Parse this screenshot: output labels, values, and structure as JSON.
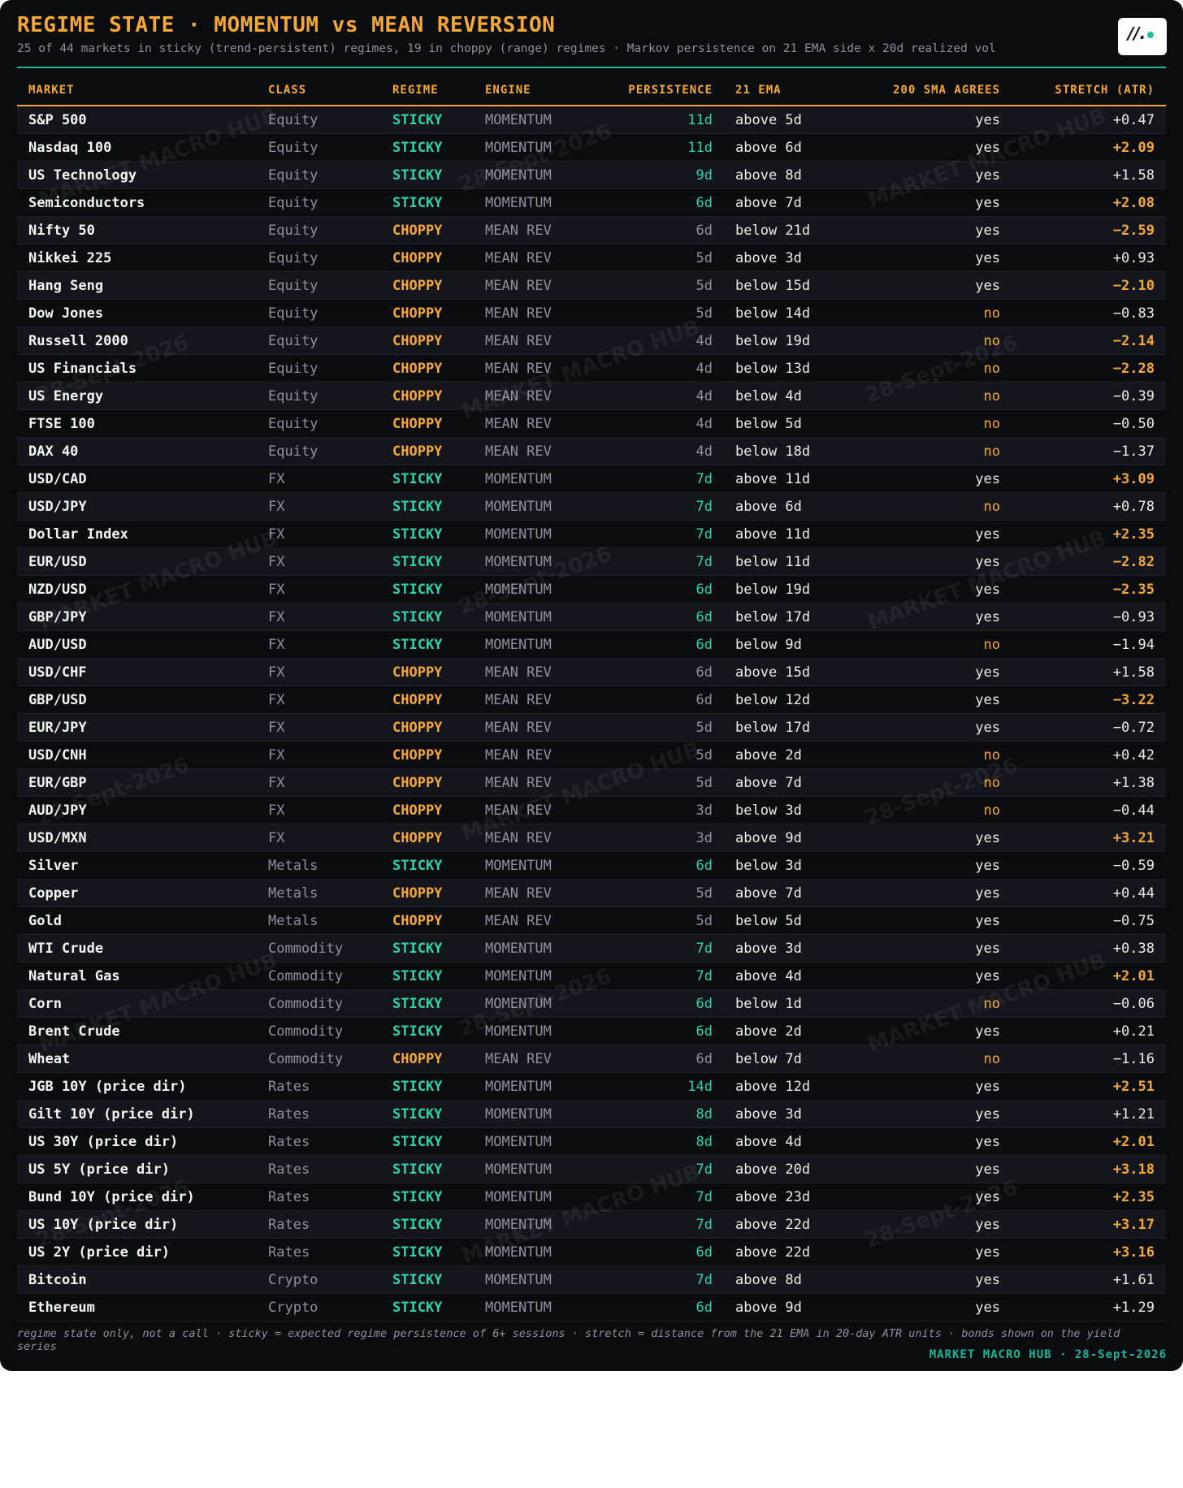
{
  "header": {
    "title": "REGIME STATE · MOMENTUM vs MEAN REVERSION",
    "subtitle": "25 of 44 markets in sticky (trend-persistent) regimes, 19 in choppy (range) regimes · Markov persistence on 21 EMA side x 20d realized vol",
    "logo_text": "MARKET MACRO HUB"
  },
  "colors": {
    "sticky": "#2ed3a8",
    "choppy": "#f6a836",
    "sticky_persistence": "#2ed3a8",
    "choppy_persistence": "#8d929b",
    "yes": "#ececec",
    "no": "#f6a836",
    "stretch_high": "#f6a836",
    "stretch_normal": "#ececec",
    "accent_rule": "#1fb596",
    "background": "#0b0c10"
  },
  "watermark": {
    "brand": "MARKET MACRO HUB",
    "date": "28-Sept-2026"
  },
  "chart_data": {
    "type": "table",
    "columns": [
      "MARKET",
      "CLASS",
      "REGIME",
      "ENGINE",
      "PERSISTENCE",
      "21 EMA",
      "200 SMA AGREES",
      "STRETCH (ATR)"
    ],
    "rows": [
      [
        "S&P 500",
        "Equity",
        "STICKY",
        "MOMENTUM",
        "11d",
        "above 5d",
        "yes",
        "+0.47"
      ],
      [
        "Nasdaq 100",
        "Equity",
        "STICKY",
        "MOMENTUM",
        "11d",
        "above 6d",
        "yes",
        "+2.09"
      ],
      [
        "US Technology",
        "Equity",
        "STICKY",
        "MOMENTUM",
        "9d",
        "above 8d",
        "yes",
        "+1.58"
      ],
      [
        "Semiconductors",
        "Equity",
        "STICKY",
        "MOMENTUM",
        "6d",
        "above 7d",
        "yes",
        "+2.08"
      ],
      [
        "Nifty 50",
        "Equity",
        "CHOPPY",
        "MEAN REV",
        "6d",
        "below 21d",
        "yes",
        "−2.59"
      ],
      [
        "Nikkei 225",
        "Equity",
        "CHOPPY",
        "MEAN REV",
        "5d",
        "above 3d",
        "yes",
        "+0.93"
      ],
      [
        "Hang Seng",
        "Equity",
        "CHOPPY",
        "MEAN REV",
        "5d",
        "below 15d",
        "yes",
        "−2.10"
      ],
      [
        "Dow Jones",
        "Equity",
        "CHOPPY",
        "MEAN REV",
        "5d",
        "below 14d",
        "no",
        "−0.83"
      ],
      [
        "Russell 2000",
        "Equity",
        "CHOPPY",
        "MEAN REV",
        "4d",
        "below 19d",
        "no",
        "−2.14"
      ],
      [
        "US Financials",
        "Equity",
        "CHOPPY",
        "MEAN REV",
        "4d",
        "below 13d",
        "no",
        "−2.28"
      ],
      [
        "US Energy",
        "Equity",
        "CHOPPY",
        "MEAN REV",
        "4d",
        "below 4d",
        "no",
        "−0.39"
      ],
      [
        "FTSE 100",
        "Equity",
        "CHOPPY",
        "MEAN REV",
        "4d",
        "below 5d",
        "no",
        "−0.50"
      ],
      [
        "DAX 40",
        "Equity",
        "CHOPPY",
        "MEAN REV",
        "4d",
        "below 18d",
        "no",
        "−1.37"
      ],
      [
        "USD/CAD",
        "FX",
        "STICKY",
        "MOMENTUM",
        "7d",
        "above 11d",
        "yes",
        "+3.09"
      ],
      [
        "USD/JPY",
        "FX",
        "STICKY",
        "MOMENTUM",
        "7d",
        "above 6d",
        "no",
        "+0.78"
      ],
      [
        "Dollar Index",
        "FX",
        "STICKY",
        "MOMENTUM",
        "7d",
        "above 11d",
        "yes",
        "+2.35"
      ],
      [
        "EUR/USD",
        "FX",
        "STICKY",
        "MOMENTUM",
        "7d",
        "below 11d",
        "yes",
        "−2.82"
      ],
      [
        "NZD/USD",
        "FX",
        "STICKY",
        "MOMENTUM",
        "6d",
        "below 19d",
        "yes",
        "−2.35"
      ],
      [
        "GBP/JPY",
        "FX",
        "STICKY",
        "MOMENTUM",
        "6d",
        "below 17d",
        "yes",
        "−0.93"
      ],
      [
        "AUD/USD",
        "FX",
        "STICKY",
        "MOMENTUM",
        "6d",
        "below 9d",
        "no",
        "−1.94"
      ],
      [
        "USD/CHF",
        "FX",
        "CHOPPY",
        "MEAN REV",
        "6d",
        "above 15d",
        "yes",
        "+1.58"
      ],
      [
        "GBP/USD",
        "FX",
        "CHOPPY",
        "MEAN REV",
        "6d",
        "below 12d",
        "yes",
        "−3.22"
      ],
      [
        "EUR/JPY",
        "FX",
        "CHOPPY",
        "MEAN REV",
        "5d",
        "below 17d",
        "yes",
        "−0.72"
      ],
      [
        "USD/CNH",
        "FX",
        "CHOPPY",
        "MEAN REV",
        "5d",
        "above 2d",
        "no",
        "+0.42"
      ],
      [
        "EUR/GBP",
        "FX",
        "CHOPPY",
        "MEAN REV",
        "5d",
        "above 7d",
        "no",
        "+1.38"
      ],
      [
        "AUD/JPY",
        "FX",
        "CHOPPY",
        "MEAN REV",
        "3d",
        "below 3d",
        "no",
        "−0.44"
      ],
      [
        "USD/MXN",
        "FX",
        "CHOPPY",
        "MEAN REV",
        "3d",
        "above 9d",
        "yes",
        "+3.21"
      ],
      [
        "Silver",
        "Metals",
        "STICKY",
        "MOMENTUM",
        "6d",
        "below 3d",
        "yes",
        "−0.59"
      ],
      [
        "Copper",
        "Metals",
        "CHOPPY",
        "MEAN REV",
        "5d",
        "above 7d",
        "yes",
        "+0.44"
      ],
      [
        "Gold",
        "Metals",
        "CHOPPY",
        "MEAN REV",
        "5d",
        "below 5d",
        "yes",
        "−0.75"
      ],
      [
        "WTI Crude",
        "Commodity",
        "STICKY",
        "MOMENTUM",
        "7d",
        "above 3d",
        "yes",
        "+0.38"
      ],
      [
        "Natural Gas",
        "Commodity",
        "STICKY",
        "MOMENTUM",
        "7d",
        "above 4d",
        "yes",
        "+2.01"
      ],
      [
        "Corn",
        "Commodity",
        "STICKY",
        "MOMENTUM",
        "6d",
        "below 1d",
        "no",
        "−0.06"
      ],
      [
        "Brent Crude",
        "Commodity",
        "STICKY",
        "MOMENTUM",
        "6d",
        "above 2d",
        "yes",
        "+0.21"
      ],
      [
        "Wheat",
        "Commodity",
        "CHOPPY",
        "MEAN REV",
        "6d",
        "below 7d",
        "no",
        "−1.16"
      ],
      [
        "JGB 10Y (price dir)",
        "Rates",
        "STICKY",
        "MOMENTUM",
        "14d",
        "above 12d",
        "yes",
        "+2.51"
      ],
      [
        "Gilt 10Y (price dir)",
        "Rates",
        "STICKY",
        "MOMENTUM",
        "8d",
        "above 3d",
        "yes",
        "+1.21"
      ],
      [
        "US 30Y (price dir)",
        "Rates",
        "STICKY",
        "MOMENTUM",
        "8d",
        "above 4d",
        "yes",
        "+2.01"
      ],
      [
        "US 5Y (price dir)",
        "Rates",
        "STICKY",
        "MOMENTUM",
        "7d",
        "above 20d",
        "yes",
        "+3.18"
      ],
      [
        "Bund 10Y (price dir)",
        "Rates",
        "STICKY",
        "MOMENTUM",
        "7d",
        "above 23d",
        "yes",
        "+2.35"
      ],
      [
        "US 10Y (price dir)",
        "Rates",
        "STICKY",
        "MOMENTUM",
        "7d",
        "above 22d",
        "yes",
        "+3.17"
      ],
      [
        "US 2Y (price dir)",
        "Rates",
        "STICKY",
        "MOMENTUM",
        "6d",
        "above 22d",
        "yes",
        "+3.16"
      ],
      [
        "Bitcoin",
        "Crypto",
        "STICKY",
        "MOMENTUM",
        "7d",
        "above 8d",
        "yes",
        "+1.61"
      ],
      [
        "Ethereum",
        "Crypto",
        "STICKY",
        "MOMENTUM",
        "6d",
        "above 9d",
        "yes",
        "+1.29"
      ]
    ]
  },
  "footer": {
    "note": "regime state only, not a call · sticky = expected regime persistence of 6+ sessions · stretch = distance from the 21 EMA in 20-day ATR units · bonds shown on the yield series",
    "brand": "MARKET MACRO HUB · 28-Sept-2026"
  }
}
